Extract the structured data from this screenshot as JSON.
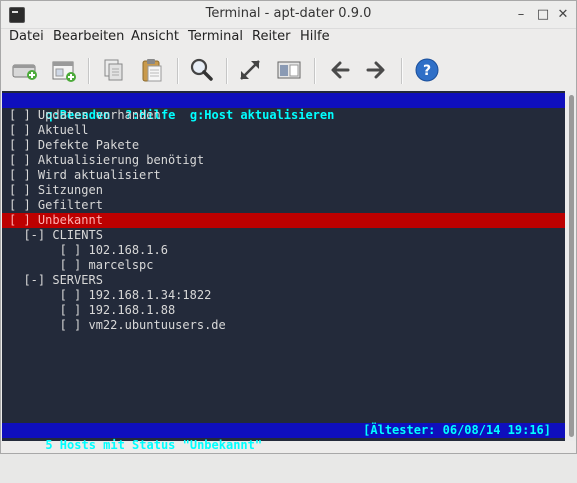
{
  "window": {
    "title": "Terminal - apt-dater 0.9.0"
  },
  "menu": [
    "Datei",
    "Bearbeiten",
    "Ansicht",
    "Terminal",
    "Reiter",
    "Hilfe"
  ],
  "toolbar": {
    "icons": [
      "new-tab-icon",
      "new-window-icon",
      "copy-icon",
      "paste-icon",
      "search-icon",
      "fullscreen-icon",
      "split-view-icon",
      "back-arrow-icon",
      "forward-arrow-icon",
      "help-icon"
    ]
  },
  "terminal": {
    "header": "q:Beenden  ?:Hilfe  g:Host aktualisieren",
    "lines": [
      "[ ] Updates vorhanden",
      "[ ] Aktuell",
      "[ ] Defekte Pakete",
      "[ ] Aktualisierung benötigt",
      "[ ] Wird aktualisiert",
      "[ ] Sitzungen",
      "[ ] Gefiltert",
      "[ ] Unbekannt",
      "  [-] CLIENTS",
      "       [ ] 102.168.1.6",
      "       [ ] marcelspc",
      "  [-] SERVERS",
      "       [ ] 192.168.1.34:1822",
      "       [ ] 192.168.1.88",
      "       [ ] vm22.ubuntuusers.de"
    ],
    "selected_index": 7,
    "status_left": "5 Hosts mit Status \"Unbekannt\"",
    "status_right": "[Ältester: 06/08/14 19:16]"
  }
}
